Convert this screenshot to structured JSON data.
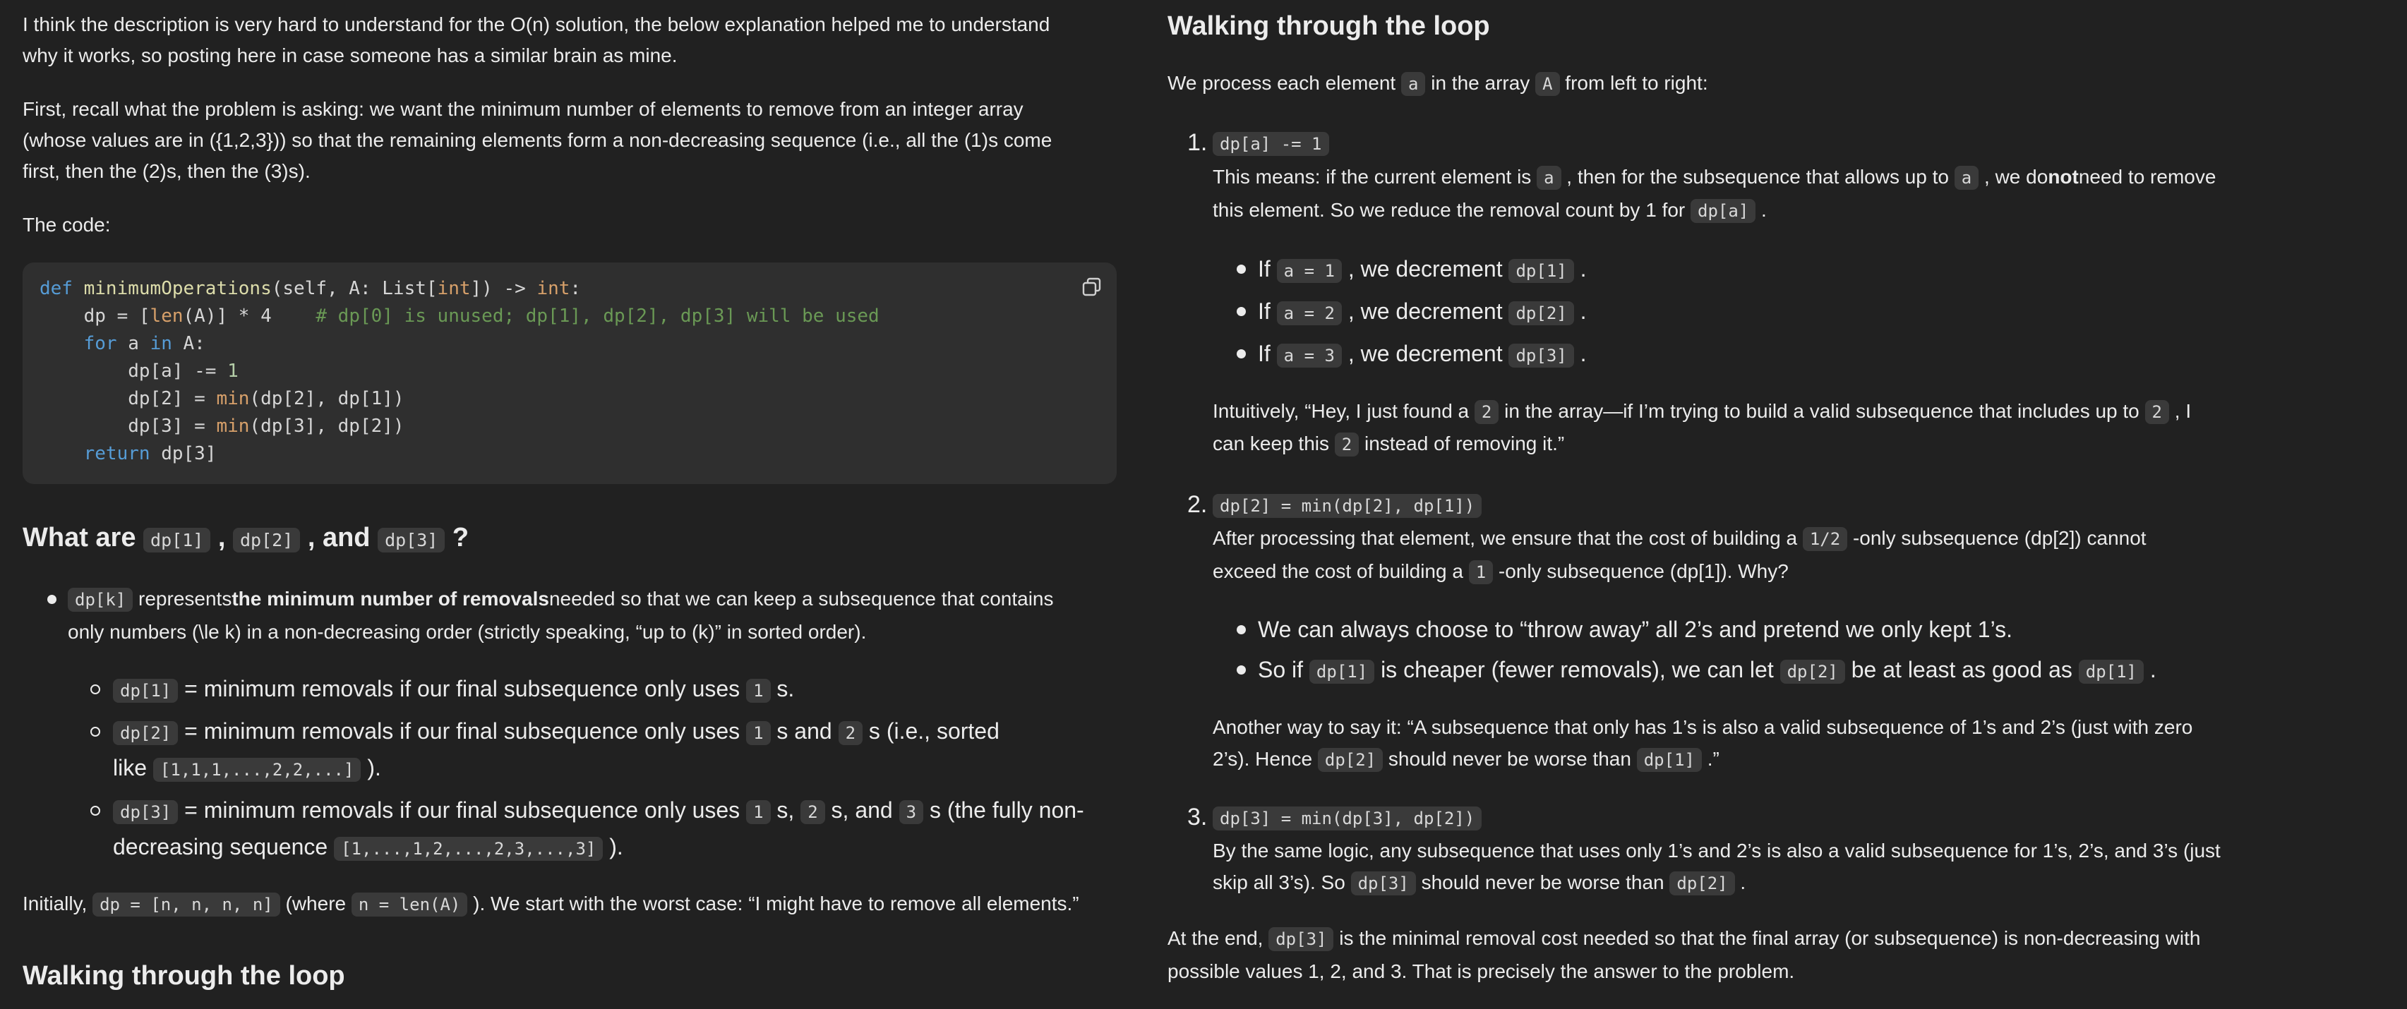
{
  "left": {
    "intro_1": "I think the description is very hard to understand for the O(n) solution, the below explanation helped me to understand",
    "intro_2": "why it works, so posting here in case someone has a similar brain as mine.",
    "recall_1": "First, recall what the problem is asking: we want the minimum number of elements to remove from an integer array",
    "recall_2": "(whose values are in ({1,2,3})) so that the remaining elements form a non-decreasing sequence (i.e., all the (1)s come",
    "recall_3": "first, then the (2)s, then the (3)s).",
    "code_label": "The code:",
    "code": {
      "l1_def": "def",
      "l1_fn": "minimumOperations",
      "l1_a": "(self, A: List[",
      "l1_int": "int",
      "l1_b": "]) -> ",
      "l1_ret": "int",
      "l1_c": ":",
      "l2_a": "    dp = [",
      "l2_len": "len",
      "l2_b": "(A)] * 4    ",
      "l2_comment": "# dp[0] is unused; dp[1], dp[2], dp[3] will be used",
      "l3_for": "for",
      "l3_a": " a ",
      "l3_in": "in",
      "l3_b": " A:",
      "l4_a": "        dp[a] -= ",
      "l4_num": "1",
      "l5_a": "        dp[2] = ",
      "l5_min": "min",
      "l5_b": "(dp[2], dp[1])",
      "l6_a": "        dp[3] = ",
      "l6_min": "min",
      "l6_b": "(dp[3], dp[2])",
      "l7_return": "return",
      "l7_a": " dp[3]"
    },
    "heading": {
      "pre": "What are ",
      "c1": "dp[1]",
      "sep1": " , ",
      "c2": "dp[2]",
      "sep2": " , and ",
      "c3": "dp[3]",
      "post": " ?"
    },
    "dpk": {
      "code": "dp[k]",
      "t1": " represents",
      "bold": "the minimum number of removals",
      "t2": "needed so that we can keep a subsequence that contains",
      "line2": "only numbers (\\le k) in a non-decreasing order (strictly speaking, “up to (k)” in sorted order)."
    },
    "s1": {
      "code": "dp[1]",
      "t1": " = minimum removals if our final subsequence only uses ",
      "c1": "1",
      "t2": " s."
    },
    "s2": {
      "code": "dp[2]",
      "t1": " = minimum removals if our final subsequence only uses ",
      "c1": "1",
      "t2": " s and ",
      "c2": "2",
      "t3": " s (i.e., sorted",
      "l2a": "like ",
      "c3": "[1,1,1,...,2,2,...]",
      "l2b": " )."
    },
    "s3": {
      "code": "dp[3]",
      "t1": " = minimum removals if our final subsequence only uses ",
      "c1": "1",
      "t2": " s, ",
      "c2": "2",
      "t3": " s, and ",
      "c3": "3",
      "t4": " s (the fully non-",
      "l2a": "decreasing sequence ",
      "c4": "[1,...,1,2,...,2,3,...,3]",
      "l2b": " )."
    },
    "initially": {
      "t1": "Initially, ",
      "c1": "dp = [n, n, n, n]",
      "t2": " (where ",
      "c2": "n = len(A)",
      "t3": " ). We start with the worst case: “I might have to remove all elements.”"
    },
    "loop_heading": "Walking through the loop"
  },
  "right": {
    "heading": "Walking through the loop",
    "process": {
      "t1": "We process each element ",
      "c1": "a",
      "t2": " in the array ",
      "c2": "A",
      "t3": " from left to right:"
    },
    "step1": {
      "num": "1.",
      "code": "dp[a] -= 1",
      "l1a": "This means: if the current element is ",
      "c1": "a",
      "l1b": " , then for the subsequence that allows up to ",
      "c2": "a",
      "l1c": " , we do",
      "bold": "not",
      "l1d": "need to remove",
      "l2a": "this element. So we reduce the removal count by 1 for ",
      "c3": "dp[a]",
      "l2b": " .",
      "b1": {
        "t1": "If ",
        "c1": "a = 1",
        "t2": " , we decrement ",
        "c2": "dp[1]",
        "t3": " ."
      },
      "b2": {
        "t1": "If ",
        "c1": "a = 2",
        "t2": " , we decrement ",
        "c2": "dp[2]",
        "t3": " ."
      },
      "b3": {
        "t1": "If ",
        "c1": "a = 3",
        "t2": " , we decrement ",
        "c2": "dp[3]",
        "t3": " ."
      },
      "int1a": "Intuitively, “Hey, I just found a ",
      "ic1": "2",
      "int1b": " in the array—if I’m trying to build a valid subsequence that includes up to ",
      "ic2": "2",
      "int1c": " , I",
      "int2a": "can keep this ",
      "ic3": "2",
      "int2b": " instead of removing it.”"
    },
    "step2": {
      "num": "2.",
      "code": "dp[2] = min(dp[2], dp[1])",
      "l1a": "After processing that element, we ensure that the cost of building a ",
      "c1": "1/2",
      "l1b": " -only subsequence (dp[2]) cannot",
      "l2a": "exceed the cost of building a ",
      "c2": "1",
      "l2b": " -only subsequence (dp[1]). Why?",
      "b1": "We can always choose to “throw away” all 2’s and pretend we only kept 1’s.",
      "b2": {
        "t1": "So if ",
        "c1": "dp[1]",
        "t2": " is cheaper (fewer removals), we can let ",
        "c2": "dp[2]",
        "t3": " be at least as good as ",
        "c3": "dp[1]",
        "t4": " ."
      },
      "a1": "Another way to say it: “A subsequence that only has 1’s is also a valid subsequence of 1’s and 2’s (just with zero",
      "a2a": "2’s). Hence ",
      "ac1": "dp[2]",
      "a2b": " should never be worse than ",
      "ac2": "dp[1]",
      "a2c": " .”"
    },
    "step3": {
      "num": "3.",
      "code": "dp[3] = min(dp[3], dp[2])",
      "l1": "By the same logic, any subsequence that uses only 1’s and 2’s is also a valid subsequence for 1’s, 2’s, and 3’s (just",
      "l2a": "skip all 3’s). So ",
      "c1": "dp[3]",
      "l2b": " should never be worse than ",
      "c2": "dp[2]",
      "l2c": " ."
    },
    "end": {
      "t1": "At the end, ",
      "c1": "dp[3]",
      "t2": " is the minimal removal cost needed so that the final array (or subsequence) is non-decreasing with",
      "l2": "possible values 1, 2, and 3. That is precisely the answer to the problem."
    }
  },
  "icons": {
    "copy": "copy-icon"
  },
  "colors": {
    "background": "#212121",
    "code_block": "#2f2f2f",
    "inline_code": "#3a3a3a",
    "text": "#ececec"
  }
}
